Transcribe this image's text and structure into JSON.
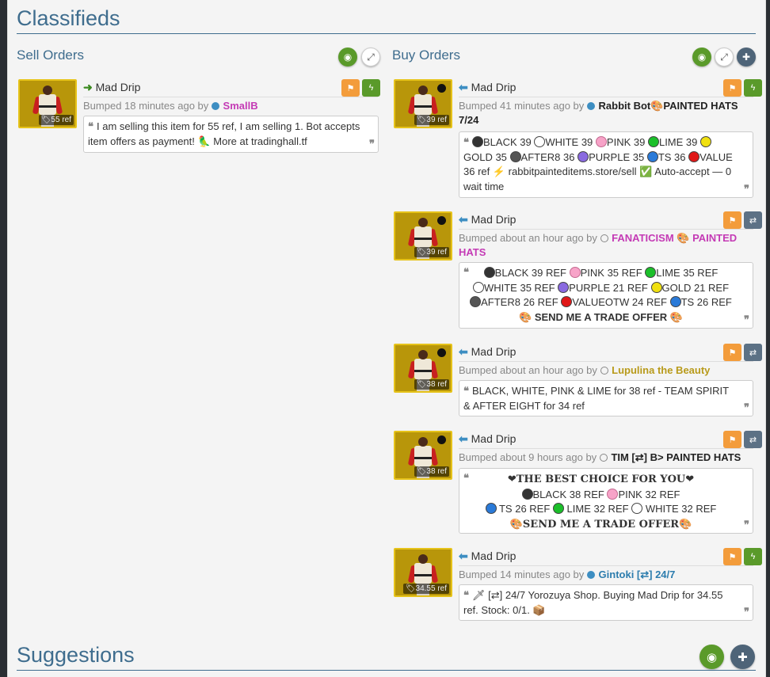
{
  "page": {
    "title": "Classifieds",
    "suggestions_title": "Suggestions"
  },
  "sell": {
    "title": "Sell Orders",
    "listings": [
      {
        "item_name": "Mad Drip",
        "price": "55 ref",
        "bumped": "Bumped 18 minutes ago by",
        "user": "SmallB",
        "message": "I am selling this item for 55 ref, I am selling 1. Bot accepts item offers as payment! 🦜 More at tradinghall.tf"
      }
    ]
  },
  "buy": {
    "title": "Buy Orders",
    "listings": [
      {
        "item_name": "Mad Drip",
        "price": "39 ref",
        "bumped": "Bumped 41 minutes ago by",
        "user": "Rabbit Bot",
        "user_suffix": "🎨PAINTED HATS 7/24",
        "message": "BLACK 39 | WHITE 39 | PINK 39 | LIME 39 | GOLD 35 | AFTER8 36 | PURPLE 35 | TS 36 | VALUE 36 ref ⚡ rabbitpainteditems.store/sell ✅ Auto-accept — 0 wait time",
        "msg_parts": {
          "black": "BLACK 39",
          "white": "WHITE 39",
          "pink": "PINK 39",
          "lime": "LIME 39",
          "gold": "GOLD 35",
          "after8": "AFTER8 36",
          "purple": "PURPLE 35",
          "ts": "TS 36",
          "value": "VALUE 36 ref",
          "site": "rabbitpainteditems.store/sell",
          "auto": "Auto-accept — 0 wait time"
        }
      },
      {
        "item_name": "Mad Drip",
        "price": "39 ref",
        "bumped": "Bumped about an hour ago by",
        "user": "FANATICISM",
        "user_suffix": "🎨 PAINTED HATS",
        "msg_parts": {
          "black": "BLACK 39 REF",
          "pink": "PINK 35 REF",
          "lime": "LIME 35 REF",
          "white": "WHITE 35 REF",
          "purple": "PURPLE 21 REF",
          "gold": "GOLD 21 REF",
          "after8": "AFTER8 26 REF",
          "value": "VALUEOTW 24 REF",
          "ts": "TS 26 REF",
          "cta": "SEND ME A TRADE OFFER"
        }
      },
      {
        "item_name": "Mad Drip",
        "price": "38 ref",
        "bumped": "Bumped about an hour ago by",
        "user": "Lupulina the Beauty",
        "message": "BLACK, WHITE, PINK & LIME for 38 ref - TEAM SPIRIT & AFTER EIGHT for 34 ref"
      },
      {
        "item_name": "Mad Drip",
        "price": "38 ref",
        "bumped": "Bumped about 9 hours ago by",
        "user": "TIM [⇄] B> PAINTED HATS",
        "msg_parts": {
          "headline": "THE BEST CHOICE FOR YOU",
          "black": "BLACK 38 REF",
          "pink": "PINK 32 REF",
          "ts": "TS 26 REF",
          "lime": "LIME 32 REF",
          "white": "WHITE 32 REF",
          "cta": "SEND ME A TRADE OFFER"
        }
      },
      {
        "item_name": "Mad Drip",
        "price": "34.55 ref",
        "bumped": "Bumped 14 minutes ago by",
        "user": "Gintoki [⇄] 24/7",
        "message": "🗡 [⇄] 24/7 Yorozuya Shop. Buying Mad Drip for 34.55 ref. Stock: 0/1. 📦"
      }
    ]
  },
  "colors": {
    "accent": "#3f6d8e",
    "orange": "#f39c3b",
    "green": "#5a9a2a",
    "slate": "#5c7185"
  },
  "icons": {
    "eye": "eye-slash-icon",
    "expand": "expand-icon",
    "add": "plus-icon",
    "flag": "flag-icon",
    "bolt": "lightning-icon",
    "swap": "exchange-icon",
    "quote": "quote-icon"
  }
}
